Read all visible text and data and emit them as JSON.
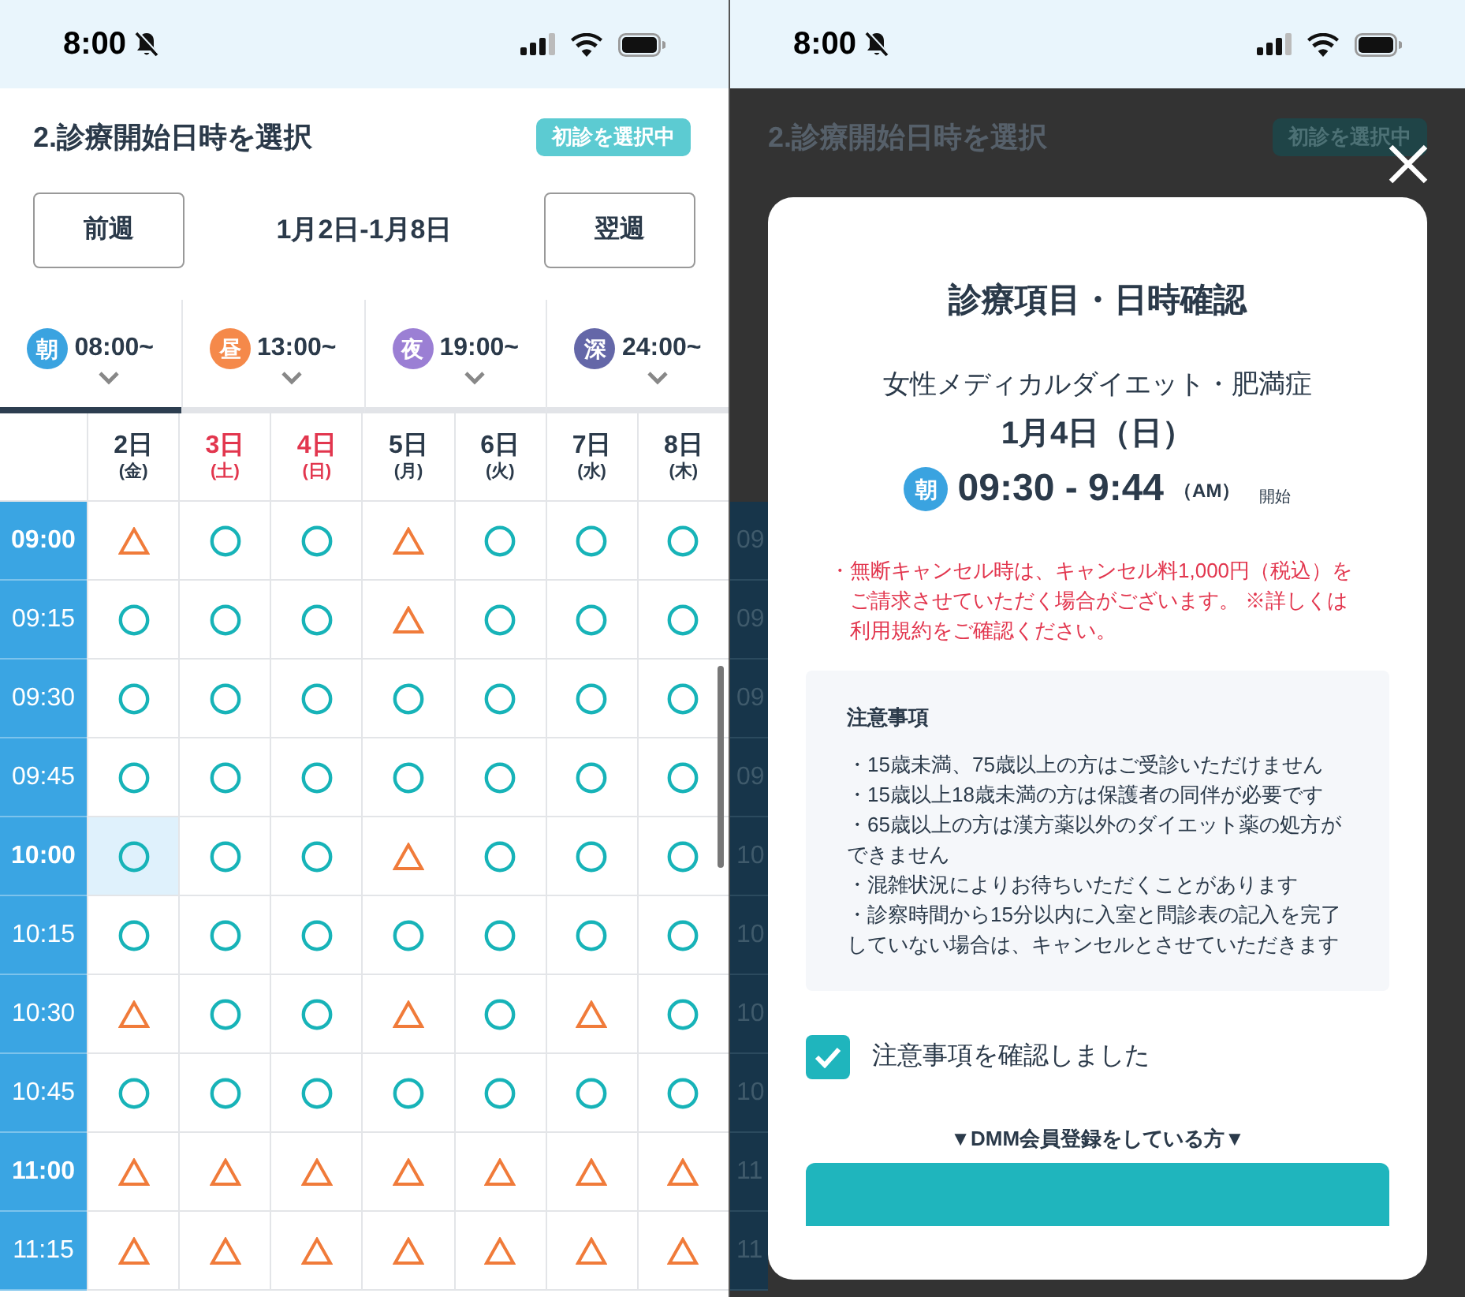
{
  "left_screen": {
    "status_bar": {
      "time": "8:00"
    },
    "header": {
      "title": "2.診療開始日時を選択",
      "badge": "初診を選択中"
    },
    "week_nav": {
      "prev": "前週",
      "range": "1月2日-1月8日",
      "next": "翌週"
    },
    "time_tabs": [
      {
        "badge": "朝",
        "label": "08:00~",
        "color": "#3aa3e0",
        "selected": true
      },
      {
        "badge": "昼",
        "label": "13:00~",
        "color": "#f5894a",
        "selected": false
      },
      {
        "badge": "夜",
        "label": "19:00~",
        "color": "#9b7fd4",
        "selected": false
      },
      {
        "badge": "深",
        "label": "24:00~",
        "color": "#6467a8",
        "selected": false
      }
    ],
    "days": [
      {
        "day": "2日",
        "weekday": "(金)",
        "holiday": false
      },
      {
        "day": "3日",
        "weekday": "(土)",
        "holiday": true
      },
      {
        "day": "4日",
        "weekday": "(日)",
        "holiday": true
      },
      {
        "day": "5日",
        "weekday": "(月)",
        "holiday": false
      },
      {
        "day": "6日",
        "weekday": "(火)",
        "holiday": false
      },
      {
        "day": "7日",
        "weekday": "(水)",
        "holiday": false
      },
      {
        "day": "8日",
        "weekday": "(木)",
        "holiday": false
      }
    ],
    "rows": [
      {
        "time": "09:00",
        "major": true,
        "slots": [
          {
            "kind": "few",
            "selected": false
          },
          {
            "kind": "open",
            "selected": false
          },
          {
            "kind": "open",
            "selected": false
          },
          {
            "kind": "few",
            "selected": false
          },
          {
            "kind": "open",
            "selected": false
          },
          {
            "kind": "open",
            "selected": false
          },
          {
            "kind": "open",
            "selected": false
          }
        ]
      },
      {
        "time": "09:15",
        "major": false,
        "slots": [
          {
            "kind": "open",
            "selected": false
          },
          {
            "kind": "open",
            "selected": false
          },
          {
            "kind": "open",
            "selected": false
          },
          {
            "kind": "few",
            "selected": false
          },
          {
            "kind": "open",
            "selected": false
          },
          {
            "kind": "open",
            "selected": false
          },
          {
            "kind": "open",
            "selected": false
          }
        ]
      },
      {
        "time": "09:30",
        "major": false,
        "slots": [
          {
            "kind": "open",
            "selected": false
          },
          {
            "kind": "open",
            "selected": false
          },
          {
            "kind": "open",
            "selected": false
          },
          {
            "kind": "open",
            "selected": false
          },
          {
            "kind": "open",
            "selected": false
          },
          {
            "kind": "open",
            "selected": false
          },
          {
            "kind": "open",
            "selected": false
          }
        ]
      },
      {
        "time": "09:45",
        "major": false,
        "slots": [
          {
            "kind": "open",
            "selected": false
          },
          {
            "kind": "open",
            "selected": false
          },
          {
            "kind": "open",
            "selected": false
          },
          {
            "kind": "open",
            "selected": false
          },
          {
            "kind": "open",
            "selected": false
          },
          {
            "kind": "open",
            "selected": false
          },
          {
            "kind": "open",
            "selected": false
          }
        ]
      },
      {
        "time": "10:00",
        "major": true,
        "slots": [
          {
            "kind": "open",
            "selected": true
          },
          {
            "kind": "open",
            "selected": false
          },
          {
            "kind": "open",
            "selected": false
          },
          {
            "kind": "few",
            "selected": false
          },
          {
            "kind": "open",
            "selected": false
          },
          {
            "kind": "open",
            "selected": false
          },
          {
            "kind": "open",
            "selected": false
          }
        ]
      },
      {
        "time": "10:15",
        "major": false,
        "slots": [
          {
            "kind": "open",
            "selected": false
          },
          {
            "kind": "open",
            "selected": false
          },
          {
            "kind": "open",
            "selected": false
          },
          {
            "kind": "open",
            "selected": false
          },
          {
            "kind": "open",
            "selected": false
          },
          {
            "kind": "open",
            "selected": false
          },
          {
            "kind": "open",
            "selected": false
          }
        ]
      },
      {
        "time": "10:30",
        "major": false,
        "slots": [
          {
            "kind": "few",
            "selected": false
          },
          {
            "kind": "open",
            "selected": false
          },
          {
            "kind": "open",
            "selected": false
          },
          {
            "kind": "few",
            "selected": false
          },
          {
            "kind": "open",
            "selected": false
          },
          {
            "kind": "few",
            "selected": false
          },
          {
            "kind": "open",
            "selected": false
          }
        ]
      },
      {
        "time": "10:45",
        "major": false,
        "slots": [
          {
            "kind": "open",
            "selected": false
          },
          {
            "kind": "open",
            "selected": false
          },
          {
            "kind": "open",
            "selected": false
          },
          {
            "kind": "open",
            "selected": false
          },
          {
            "kind": "open",
            "selected": false
          },
          {
            "kind": "open",
            "selected": false
          },
          {
            "kind": "open",
            "selected": false
          }
        ]
      },
      {
        "time": "11:00",
        "major": true,
        "slots": [
          {
            "kind": "few",
            "selected": false
          },
          {
            "kind": "few",
            "selected": false
          },
          {
            "kind": "few",
            "selected": false
          },
          {
            "kind": "few",
            "selected": false
          },
          {
            "kind": "few",
            "selected": false
          },
          {
            "kind": "few",
            "selected": false
          },
          {
            "kind": "few",
            "selected": false
          }
        ]
      },
      {
        "time": "11:15",
        "major": false,
        "slots": [
          {
            "kind": "few",
            "selected": false
          },
          {
            "kind": "few",
            "selected": false
          },
          {
            "kind": "few",
            "selected": false
          },
          {
            "kind": "few",
            "selected": false
          },
          {
            "kind": "few",
            "selected": false
          },
          {
            "kind": "few",
            "selected": false
          },
          {
            "kind": "few",
            "selected": false
          }
        ]
      }
    ]
  },
  "right_screen": {
    "status_bar": {
      "time": "8:00"
    },
    "background": {
      "title": "2.診療開始日時を選択",
      "badge": "初診を選択中",
      "time_fragments": [
        "09",
        "09",
        "09",
        "09",
        "10",
        "10",
        "10",
        "10",
        "11",
        "11"
      ]
    },
    "modal": {
      "title": "診療項目・日時確認",
      "treatment": "女性メディカルダイエット・肥満症",
      "date": "1月4日（日）",
      "slot": {
        "badge": "朝",
        "time": "09:30 - 9:44",
        "meridiem": "（AM）",
        "suffix": "開始"
      },
      "warning": "・無断キャンセル時は、キャンセル料1,000円（税込）をご請求させていただく場合がございます。 ※詳しくは利用規約をご確認ください。",
      "notes": {
        "heading": "注意事項",
        "items": [
          "・15歳未満、75歳以上の方はご受診いただけません",
          "・15歳以上18歳未満の方は保護者の同伴が必要です",
          "・65歳以上の方は漢方薬以外のダイエット薬の処方ができません",
          "・混雑状況によりお待ちいただくことがあります",
          "・診察時間から15分以内に入室と問診表の記入を完了していない場合は、キャンセルとさせていただきます"
        ]
      },
      "confirm": {
        "label": "注意事項を確認しました",
        "checked": true
      },
      "section_label": "▼DMM会員登録をしている方▼"
    }
  }
}
